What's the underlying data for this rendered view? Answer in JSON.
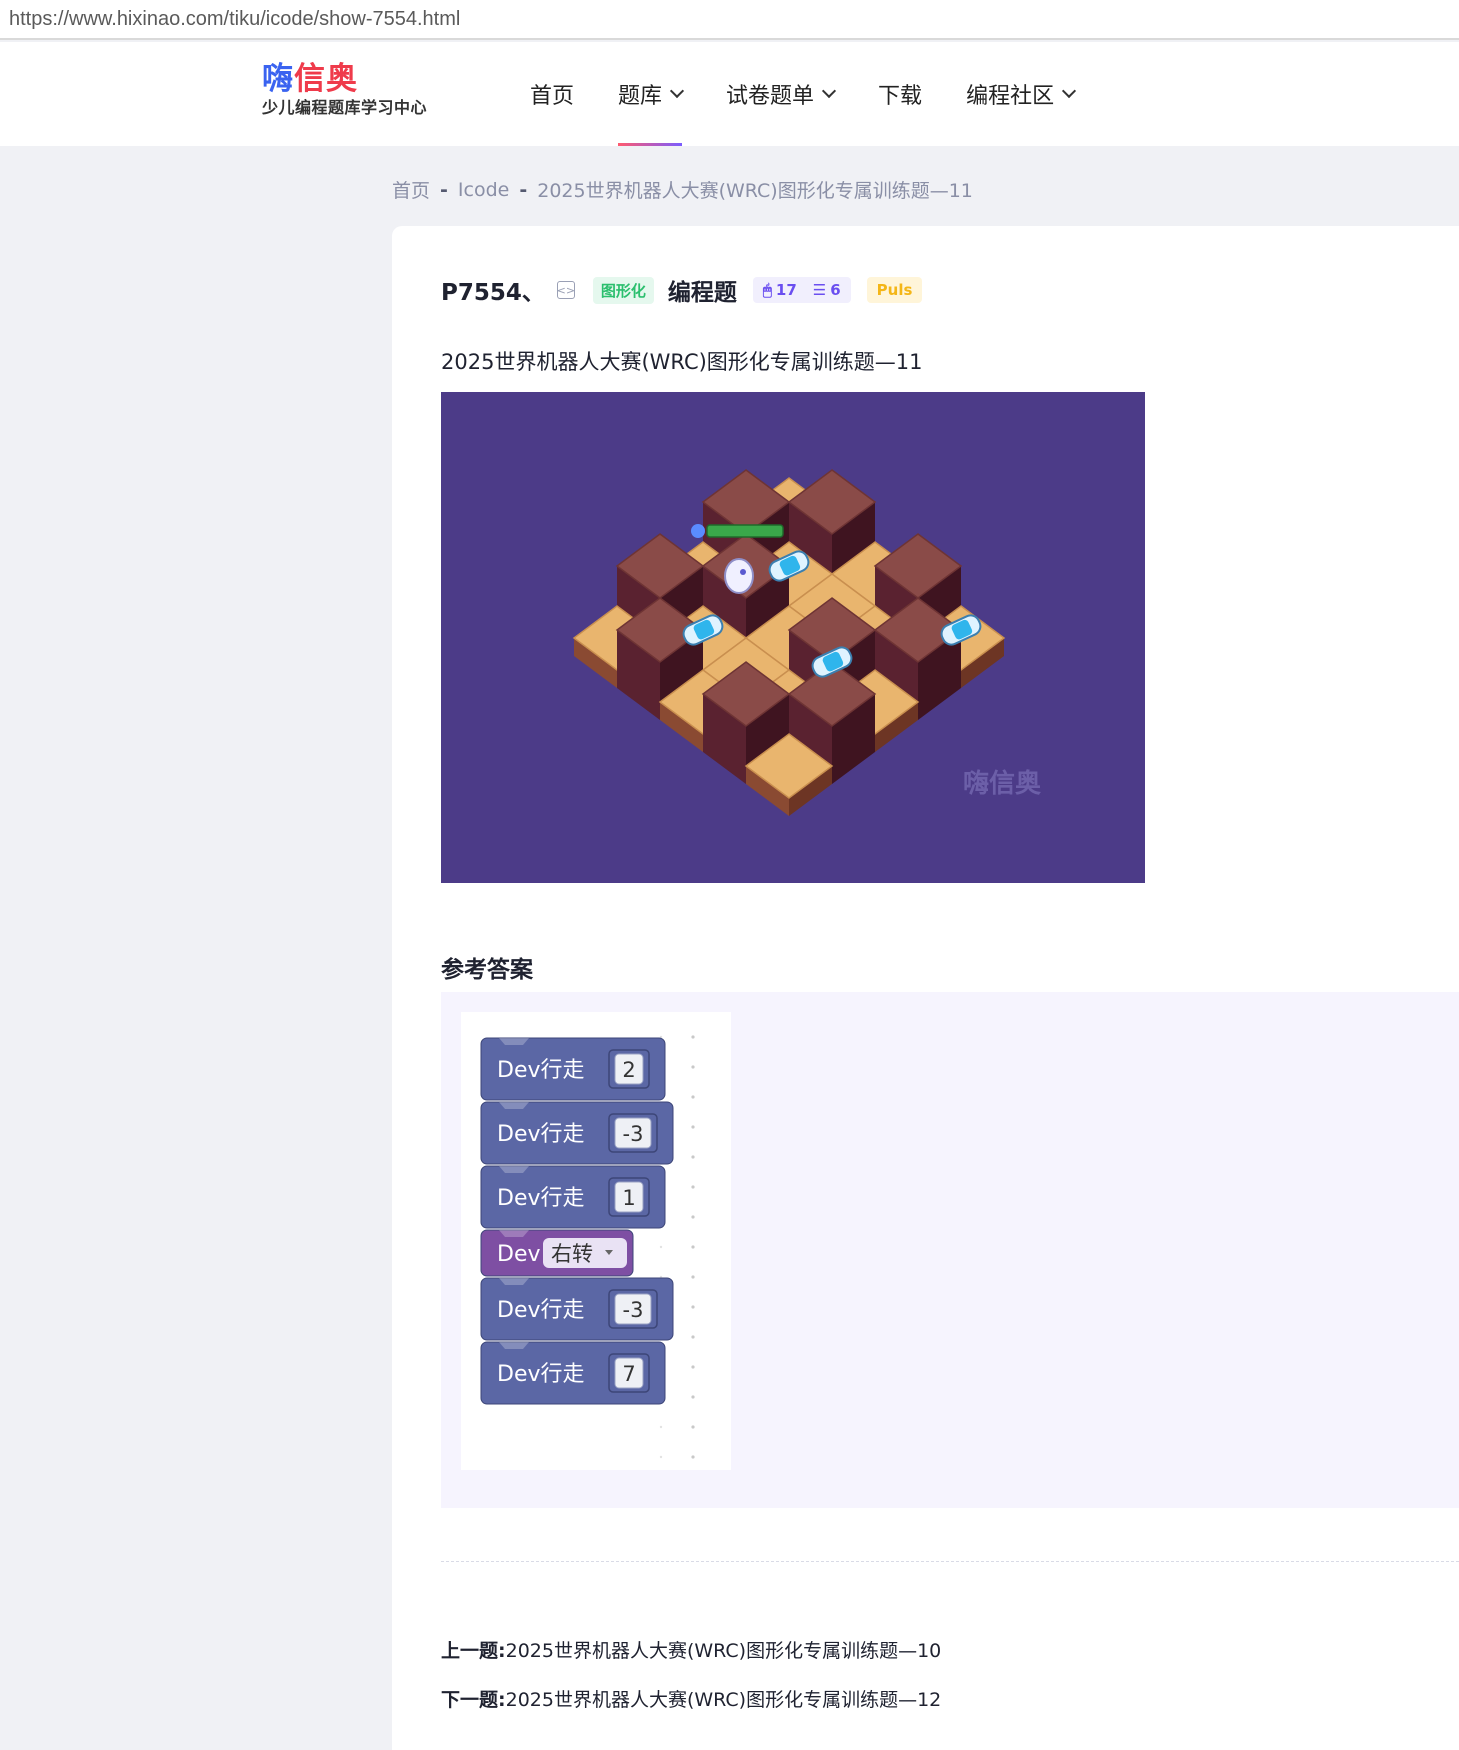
{
  "browser": {
    "url": "https://www.hixinao.com/tiku/icode/show-7554.html"
  },
  "header": {
    "logo_part1": "嗨",
    "logo_part2": "信奥",
    "logo_tagline": "少儿编程题库学习中心",
    "nav": [
      {
        "label": "首页",
        "has_dropdown": false,
        "active": false
      },
      {
        "label": "题库",
        "has_dropdown": true,
        "active": true
      },
      {
        "label": "试卷题单",
        "has_dropdown": true,
        "active": false
      },
      {
        "label": "下载",
        "has_dropdown": false,
        "active": false
      },
      {
        "label": "编程社区",
        "has_dropdown": true,
        "active": false
      }
    ]
  },
  "breadcrumb": {
    "items": [
      "首页",
      "Icode",
      "2025世界机器人大赛(WRC)图形化专属训练题—11"
    ],
    "separator": "-"
  },
  "problem": {
    "id": "P7554、",
    "category_tag": "图形化",
    "type": "编程题",
    "likes": "17",
    "list_count": "6",
    "level_tag": "Puls",
    "title": "2025世界机器人大赛(WRC)图形化专属训练题—11",
    "watermark": "嗨信奥"
  },
  "answer": {
    "heading": "参考答案",
    "blocks": [
      {
        "type": "move",
        "label": "Dev行走",
        "value": "2"
      },
      {
        "type": "move",
        "label": "Dev行走",
        "value": "-3"
      },
      {
        "type": "move",
        "label": "Dev行走",
        "value": "1"
      },
      {
        "type": "turn",
        "label": "Dev",
        "value": "右转"
      },
      {
        "type": "move",
        "label": "Dev行走",
        "value": "-3"
      },
      {
        "type": "move",
        "label": "Dev行走",
        "value": "7"
      }
    ]
  },
  "navigation": {
    "prev_label": "上一题:",
    "prev_title": "2025世界机器人大赛(WRC)图形化专属训练题—10",
    "next_label": "下一题:",
    "next_title": "2025世界机器人大赛(WRC)图形化专属训练题—12"
  },
  "colors": {
    "accent_gradient_start": "#ff5a6e",
    "accent_gradient_end": "#7a5cff",
    "puzzle_bg": "#4c3b88",
    "block_move": "#5b67a5",
    "block_turn": "#7e4fa3"
  }
}
